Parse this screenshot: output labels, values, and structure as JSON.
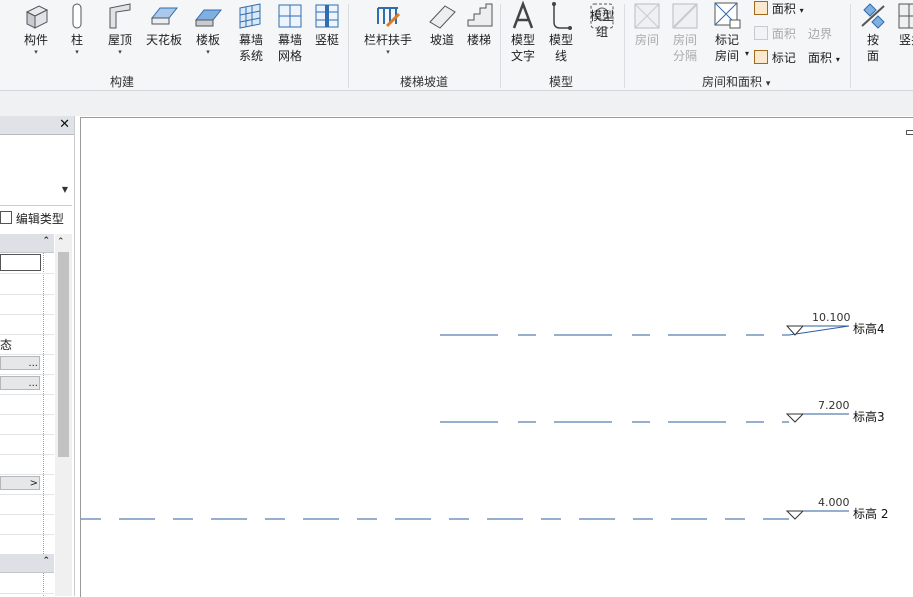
{
  "ribbon": {
    "build_tools": [
      {
        "id": "component",
        "label": "构件",
        "dropdown": true,
        "icon": "component-icon"
      },
      {
        "id": "column",
        "label": "柱",
        "dropdown": true,
        "icon": "column-icon"
      },
      {
        "id": "roof",
        "label": "屋顶",
        "dropdown": true,
        "icon": "roof-icon"
      },
      {
        "id": "ceiling",
        "label": "天花板",
        "dropdown": false,
        "icon": "ceiling-icon"
      },
      {
        "id": "floor",
        "label": "楼板",
        "dropdown": true,
        "icon": "floor-icon"
      },
      {
        "id": "curtain-system",
        "label": "幕墙",
        "label2": "系统",
        "dropdown": false,
        "icon": "curtain-system-icon"
      },
      {
        "id": "curtain-grid",
        "label": "幕墙",
        "label2": "网格",
        "dropdown": false,
        "icon": "curtain-grid-icon"
      },
      {
        "id": "mullion",
        "label": "竖梃",
        "dropdown": false,
        "icon": "mullion-icon"
      }
    ],
    "circulation_tools": [
      {
        "id": "railing",
        "label": "栏杆扶手",
        "dropdown": true,
        "icon": "railing-icon"
      },
      {
        "id": "ramp",
        "label": "坡道",
        "dropdown": false,
        "icon": "ramp-icon"
      },
      {
        "id": "stair",
        "label": "楼梯",
        "dropdown": false,
        "icon": "stair-icon"
      }
    ],
    "model_tools": [
      {
        "id": "model-text",
        "label": "模型",
        "label2": "文字",
        "dropdown": false,
        "icon": "model-text-icon"
      },
      {
        "id": "model-line",
        "label": "模型",
        "label2": "线",
        "dropdown": false,
        "icon": "model-line-icon"
      },
      {
        "id": "model-group",
        "label": "模型",
        "label2": "组",
        "dropdown": true,
        "icon": "model-group-icon"
      }
    ],
    "room_tools": [
      {
        "id": "room",
        "label": "房间",
        "disabled": true,
        "icon": "room-icon"
      },
      {
        "id": "room-separator",
        "label": "房间",
        "label2": "分隔",
        "disabled": true,
        "icon": "room-separator-icon"
      },
      {
        "id": "tag-room",
        "label": "标记",
        "label2": "房间",
        "dropdown": true,
        "disabled": false,
        "icon": "tag-room-icon"
      }
    ],
    "room_small": {
      "area": "面积",
      "area_disabled": "面积",
      "area_boundary": "边界",
      "tag": "标记",
      "area_tag": "面积"
    },
    "opening_tools": [
      {
        "id": "by-face",
        "label": "按",
        "label2": "面",
        "icon": "by-face-icon"
      },
      {
        "id": "shaft",
        "label": "竖井",
        "icon": "shaft-icon"
      }
    ],
    "groups": {
      "build": "构建",
      "circulation": "楼梯坡道",
      "model": "模型",
      "room": "房间和面积"
    }
  },
  "properties": {
    "close_glyph": "✕",
    "edit_type": "编辑类型",
    "status_fragment": "态",
    "btn_ellipsis": "...",
    "btn_arrow": ">",
    "collapse": "⌃"
  },
  "levels": [
    {
      "name": "标高4",
      "elevation": "10.100"
    },
    {
      "name": "标高3",
      "elevation": "7.200"
    },
    {
      "name": "标高 2",
      "elevation": "4.000"
    }
  ],
  "colors": {
    "level_line": "#2f5f9e",
    "ribbon_bg": "#f5f6f7",
    "icon_blue": "#3a78c2"
  }
}
